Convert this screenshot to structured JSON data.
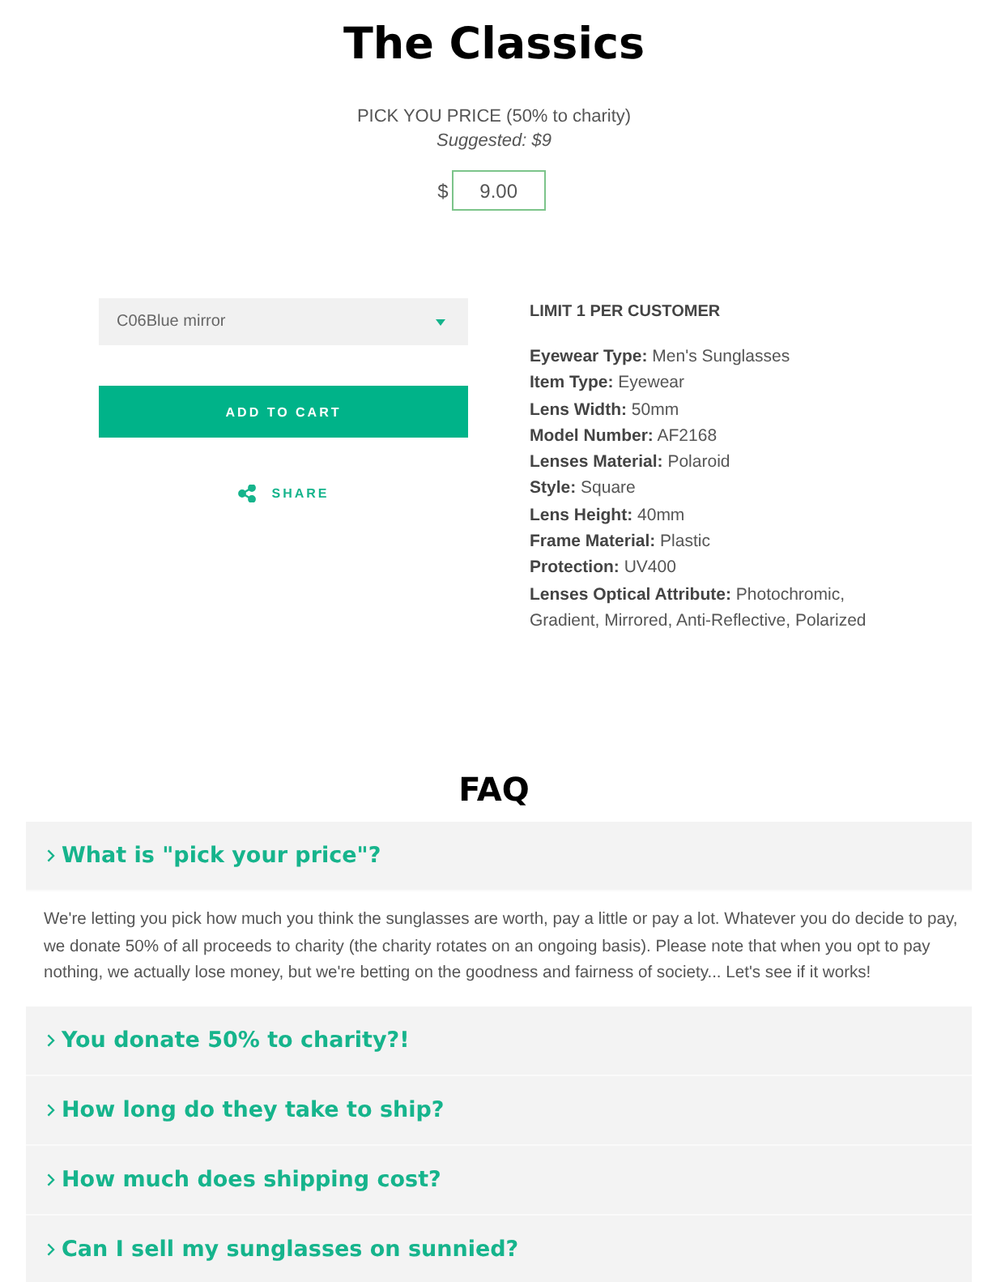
{
  "title": "The Classics",
  "pricing": {
    "label": "PICK YOU PRICE (50% to charity)",
    "suggested": "Suggested: $9",
    "currency": "$",
    "value": "9.00"
  },
  "variant_select": {
    "value": "C06Blue mirror"
  },
  "add_to_cart": "ADD TO CART",
  "share": "SHARE",
  "limit": "LIMIT 1 PER CUSTOMER",
  "specs": [
    "**Eyewear Type:** Men's Sunglasses",
    "**Item Type:** Eyewear",
    "**Lens Width:** 50mm",
    "**Model Number:** AF2168",
    "**Lenses Material:** Polaroid",
    "**Style:** Square",
    "**Lens Height:** 40mm",
    "**Frame Material:** Plastic",
    "**Protection:** UV400",
    "**Lenses Optical Attribute:** Photochromic, Gradient, Mirrored, Anti-Reflective, Polarized"
  ],
  "faq": {
    "title": "FAQ",
    "items": [
      {
        "question": "What is \"pick your price\"?",
        "answer": "We're letting you pick how much you think the sunglasses are worth, pay a little or pay a lot. Whatever you do decide to pay, we donate 50% of all proceeds to charity (the charity rotates on an ongoing basis). Please note that when you opt to pay nothing, we actually lose money, but we're betting on the goodness and fairness of society... Let's see if it works!"
      },
      {
        "question": "You donate 50% to charity?!"
      },
      {
        "question": "How long do they take to ship?"
      },
      {
        "question": "How much does shipping cost?"
      },
      {
        "question": "Can I sell my sunglasses on sunnied?"
      }
    ]
  }
}
